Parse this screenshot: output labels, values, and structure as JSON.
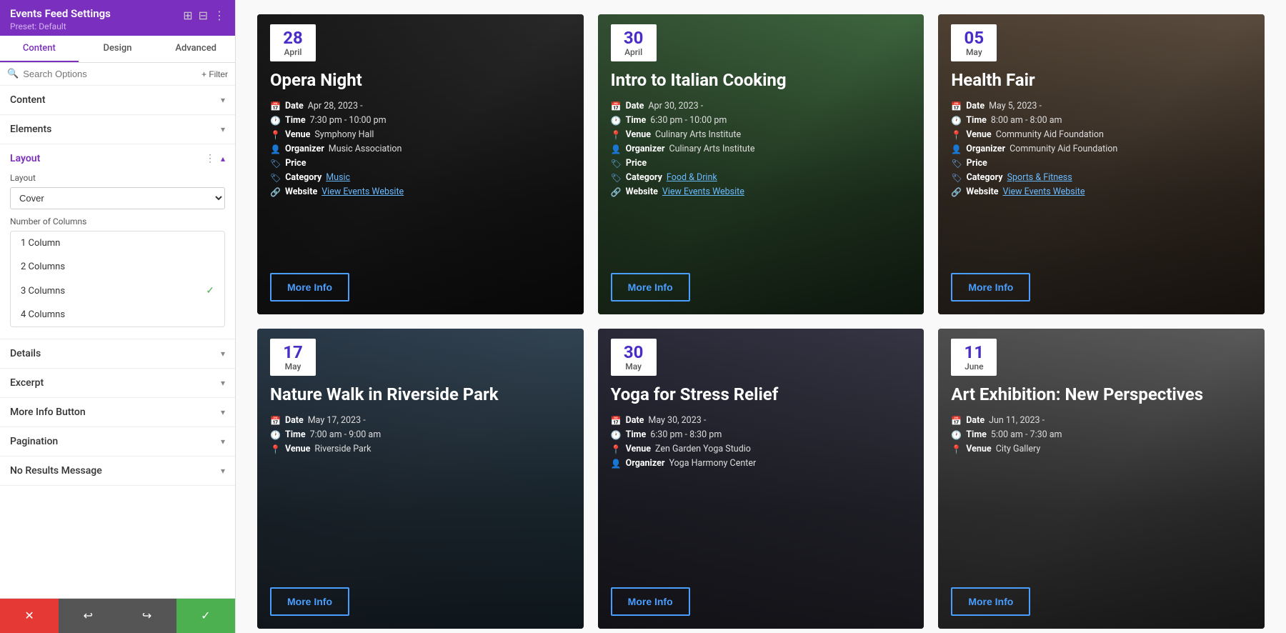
{
  "sidebar": {
    "title": "Events Feed Settings",
    "preset": "Preset: Default",
    "header_icons": [
      "⊞",
      "⊟",
      "⋮"
    ],
    "tabs": [
      {
        "label": "Content",
        "active": true
      },
      {
        "label": "Design",
        "active": false
      },
      {
        "label": "Advanced",
        "active": false
      }
    ],
    "search_placeholder": "Search Options",
    "filter_label": "+ Filter",
    "sections": [
      {
        "label": "Content",
        "expanded": false
      },
      {
        "label": "Elements",
        "expanded": false
      },
      {
        "label": "Layout",
        "expanded": true
      },
      {
        "label": "Details",
        "expanded": false
      },
      {
        "label": "Excerpt",
        "expanded": false
      },
      {
        "label": "More Info Button",
        "expanded": false
      },
      {
        "label": "Pagination",
        "expanded": false
      },
      {
        "label": "No Results Message",
        "expanded": false
      }
    ],
    "layout": {
      "label": "Layout",
      "value": "Cover",
      "columns_label": "Number of Columns",
      "columns_options": [
        {
          "label": "1 Column",
          "value": 1,
          "selected": false
        },
        {
          "label": "2 Columns",
          "value": 2,
          "selected": false
        },
        {
          "label": "3 Columns",
          "value": 3,
          "selected": true
        },
        {
          "label": "4 Columns",
          "value": 4,
          "selected": false
        }
      ]
    },
    "bottom_buttons": [
      {
        "label": "✕",
        "action": "cancel"
      },
      {
        "label": "↩",
        "action": "undo"
      },
      {
        "label": "↪",
        "action": "redo"
      },
      {
        "label": "✓",
        "action": "save"
      }
    ]
  },
  "events": [
    {
      "id": "opera-night",
      "date_day": "28",
      "date_month": "April",
      "title": "Opera Night",
      "details": [
        {
          "icon": "📅",
          "label": "Date",
          "value": "Apr 28, 2023 -"
        },
        {
          "icon": "🕐",
          "label": "Time",
          "value": "7:30 pm - 10:00 pm"
        },
        {
          "icon": "📍",
          "label": "Venue",
          "value": "Symphony Hall"
        },
        {
          "icon": "👤",
          "label": "Organizer",
          "value": "Music Association"
        },
        {
          "icon": "🏷",
          "label": "Price",
          "value": ""
        },
        {
          "icon": "🏷",
          "label": "Category",
          "value": "Music",
          "link": true
        },
        {
          "icon": "🔗",
          "label": "Website",
          "value": "View Events Website",
          "link": true
        }
      ],
      "more_info": "More Info",
      "card_class": "card-opera"
    },
    {
      "id": "italian-cooking",
      "date_day": "30",
      "date_month": "April",
      "title": "Intro to Italian Cooking",
      "details": [
        {
          "icon": "📅",
          "label": "Date",
          "value": "Apr 30, 2023 -"
        },
        {
          "icon": "🕐",
          "label": "Time",
          "value": "6:30 pm - 10:00 pm"
        },
        {
          "icon": "📍",
          "label": "Venue",
          "value": "Culinary Arts Institute"
        },
        {
          "icon": "👤",
          "label": "Organizer",
          "value": "Culinary Arts Institute"
        },
        {
          "icon": "🏷",
          "label": "Price",
          "value": ""
        },
        {
          "icon": "🏷",
          "label": "Category",
          "value": "Food & Drink",
          "link": true
        },
        {
          "icon": "🔗",
          "label": "Website",
          "value": "View Events Website",
          "link": true
        }
      ],
      "more_info": "More Info",
      "card_class": "card-italian"
    },
    {
      "id": "health-fair",
      "date_day": "05",
      "date_month": "May",
      "title": "Health Fair",
      "details": [
        {
          "icon": "📅",
          "label": "Date",
          "value": "May 5, 2023 -"
        },
        {
          "icon": "🕐",
          "label": "Time",
          "value": "8:00 am - 8:00 am"
        },
        {
          "icon": "📍",
          "label": "Venue",
          "value": "Community Aid Foundation"
        },
        {
          "icon": "👤",
          "label": "Organizer",
          "value": "Community Aid Foundation"
        },
        {
          "icon": "🏷",
          "label": "Price",
          "value": ""
        },
        {
          "icon": "🏷",
          "label": "Category",
          "value": "Sports & Fitness",
          "link": true
        },
        {
          "icon": "🔗",
          "label": "Website",
          "value": "View Events Website",
          "link": true
        }
      ],
      "more_info": "More Info",
      "card_class": "card-health"
    },
    {
      "id": "nature-walk",
      "date_day": "17",
      "date_month": "May",
      "title": "Nature Walk in Riverside Park",
      "details": [
        {
          "icon": "📅",
          "label": "Date",
          "value": "May 17, 2023 -"
        },
        {
          "icon": "🕐",
          "label": "Time",
          "value": "7:00 am - 9:00 am"
        },
        {
          "icon": "📍",
          "label": "Venue",
          "value": "Riverside Park"
        }
      ],
      "more_info": "More Info",
      "card_class": "card-nature"
    },
    {
      "id": "yoga-stress",
      "date_day": "30",
      "date_month": "May",
      "title": "Yoga for Stress Relief",
      "details": [
        {
          "icon": "📅",
          "label": "Date",
          "value": "May 30, 2023 -"
        },
        {
          "icon": "🕐",
          "label": "Time",
          "value": "6:30 pm - 8:30 pm"
        },
        {
          "icon": "📍",
          "label": "Venue",
          "value": "Zen Garden Yoga Studio"
        },
        {
          "icon": "👤",
          "label": "Organizer",
          "value": "Yoga Harmony Center"
        }
      ],
      "more_info": "More Info",
      "card_class": "card-yoga"
    },
    {
      "id": "art-exhibition",
      "date_day": "11",
      "date_month": "June",
      "title": "Art Exhibition: New Perspectives",
      "details": [
        {
          "icon": "📅",
          "label": "Date",
          "value": "Jun 11, 2023 -"
        },
        {
          "icon": "🕐",
          "label": "Time",
          "value": "5:00 am - 7:30 am"
        },
        {
          "icon": "📍",
          "label": "Venue",
          "value": "City Gallery"
        }
      ],
      "more_info": "More Info",
      "card_class": "card-art"
    }
  ]
}
